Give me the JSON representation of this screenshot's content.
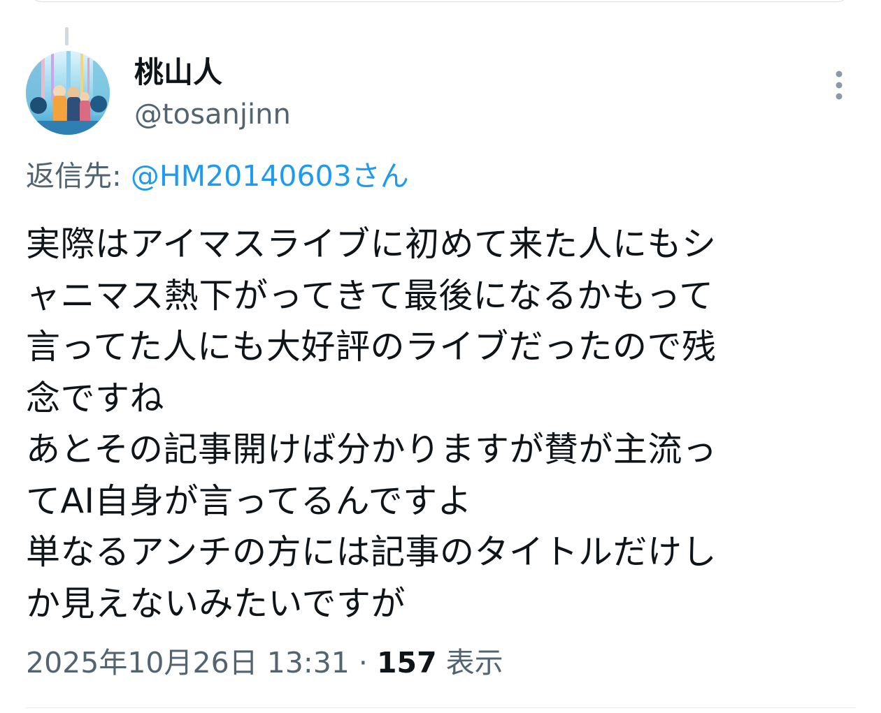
{
  "tweet": {
    "author": {
      "display_name": "桃山人",
      "handle": "@tosanjinn"
    },
    "more_icon": "more-vertical-icon",
    "reply_to": {
      "prefix": "返信先:",
      "mention": "@HM20140603さん"
    },
    "text_lines": [
      "実際はアイマスライブに初めて来た人にもシ",
      "ャニマス熱下がってきて最後になるかもって",
      "言ってた人にも大好評のライブだったので残",
      "念ですね",
      "あとその記事開けば分かりますが賛が主流っ",
      "てAI自身が言ってるんですよ",
      "単なるアンチの方には記事のタイトルだけし",
      "か見えないみたいですが"
    ],
    "timestamp": "2025年10月26日 13:31",
    "separator": "·",
    "views_count": "157",
    "views_label": "表示"
  },
  "colors": {
    "text": "#0f1419",
    "secondary": "#536471",
    "link": "#1d9bf0",
    "divider": "#e7ecf0"
  }
}
